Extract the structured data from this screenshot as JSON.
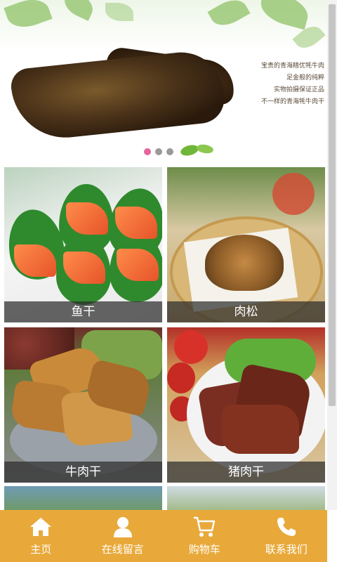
{
  "banner": {
    "caption_lines": [
      "宝贵的青海精优牦牛肉",
      "足金般的纯粹",
      "实物拍摄保证正品",
      "不一样的青海牦牛肉干"
    ],
    "slide_count": 3,
    "active_slide": 1,
    "active_dot_color": "#e5659c",
    "dot_color": "#9a9a9a"
  },
  "products": [
    {
      "label": "鱼干"
    },
    {
      "label": "肉松"
    },
    {
      "label": "牛肉干"
    },
    {
      "label": "猪肉干"
    }
  ],
  "bottom_nav": {
    "background": "#e8a93a",
    "items": [
      {
        "label": "主页",
        "icon": "home-icon"
      },
      {
        "label": "在线留言",
        "icon": "user-icon"
      },
      {
        "label": "购物车",
        "icon": "cart-icon"
      },
      {
        "label": "联系我们",
        "icon": "phone-icon"
      }
    ]
  }
}
